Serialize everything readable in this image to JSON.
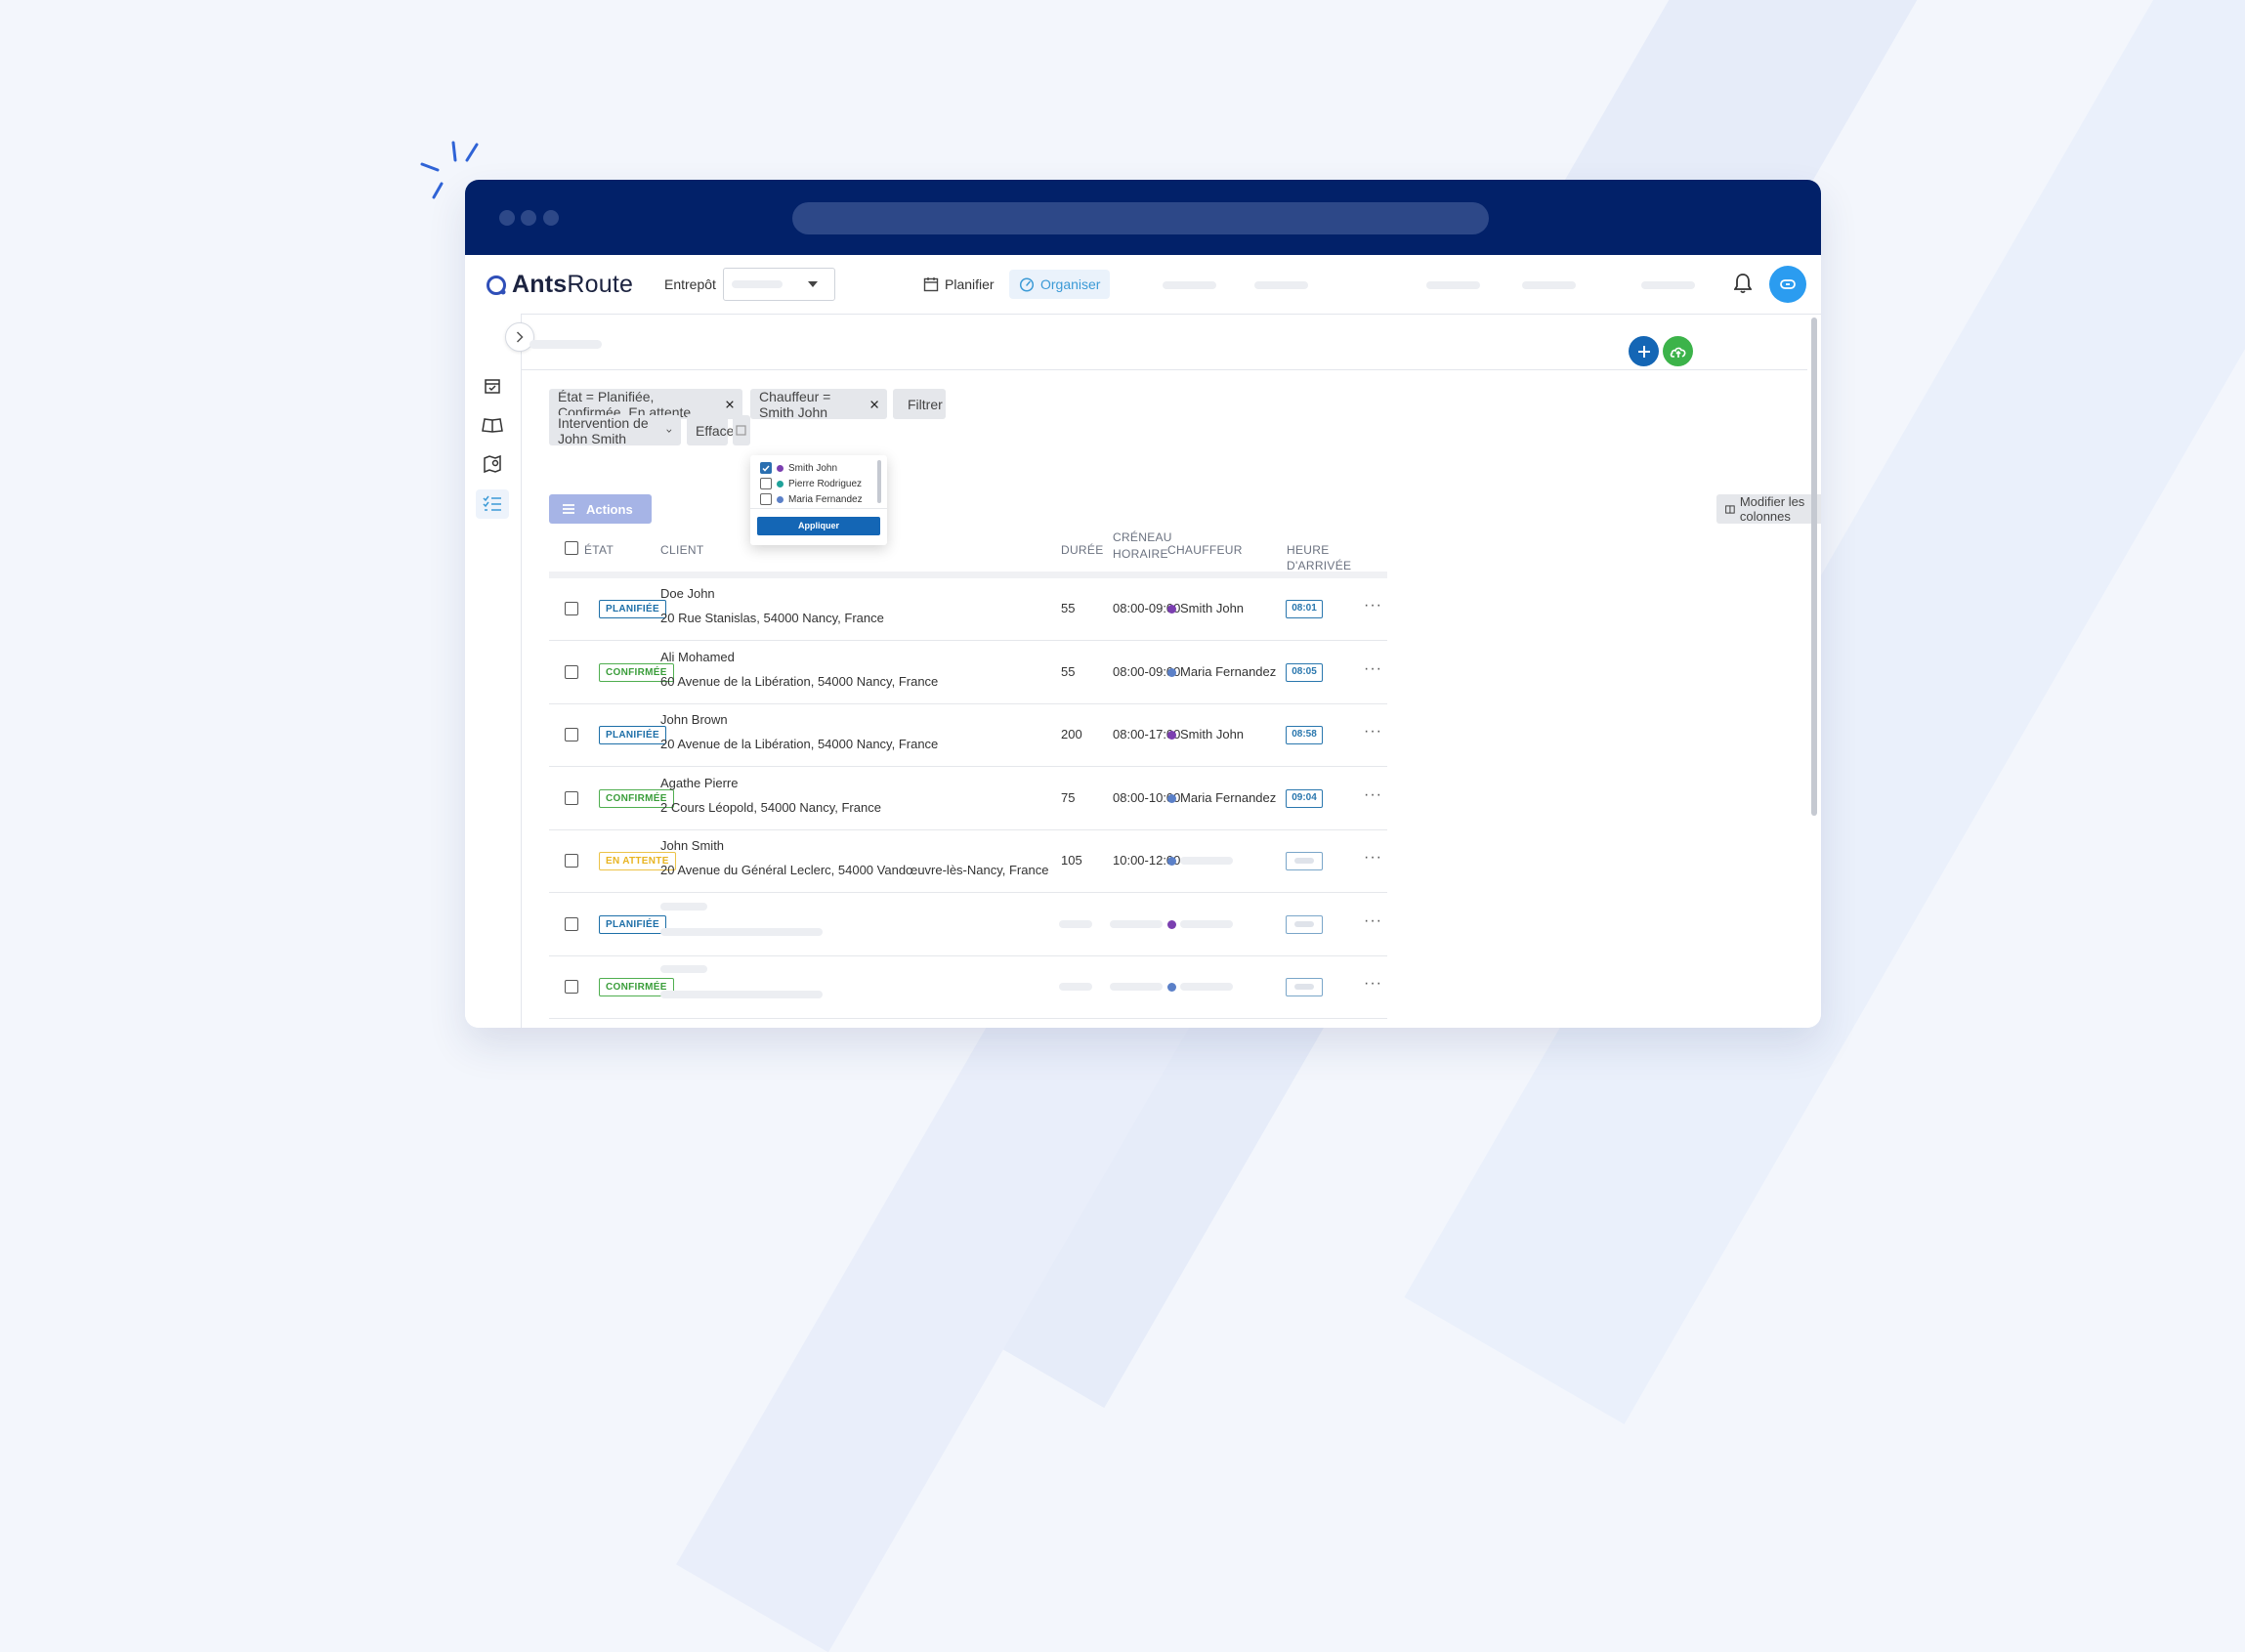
{
  "colors": {
    "chrome": "#022169",
    "accent_blue": "#3b9ad6",
    "planifiee": "#1d6fa8",
    "confirmee": "#3a9d3a",
    "en_attente": "#e8b421",
    "driver_smith": "#7b3fb0",
    "driver_maria": "#5b80c8",
    "driver_pierre": "#1fa29a",
    "apply_button": "#1466b5",
    "add_button": "#1466b5",
    "upload_button": "#3cb34a"
  },
  "header": {
    "logo_bold": "Ants",
    "logo_regular": "Route",
    "warehouse_label": "Entrepôt",
    "nav": [
      {
        "label": "Planifier",
        "icon": "calendar-icon"
      },
      {
        "label": "Organiser",
        "icon": "speedometer-icon"
      }
    ]
  },
  "filters": {
    "chip_state": "État = Planifiée, Confirmée, En attente",
    "chip_driver": "Chauffeur = Smith John",
    "filter_button": "Filtrer",
    "saved_view": "Intervention de John Smith",
    "clear_button": "Effacer"
  },
  "actions_label": "Actions",
  "columns_button": "Modifier les colonnes",
  "dropdown": {
    "options": [
      {
        "label": "Smith John",
        "checked": true,
        "color": "#7b3fb0"
      },
      {
        "label": "Pierre Rodriguez",
        "checked": false,
        "color": "#1fa29a"
      },
      {
        "label": "Maria Fernandez",
        "checked": false,
        "color": "#5b80c8"
      }
    ],
    "apply_label": "Appliquer"
  },
  "table": {
    "headers": {
      "state": "ÉTAT",
      "client": "CLIENT",
      "duration": "DURÉE",
      "slot_line1": "CRÉNEAU",
      "slot_line2": "HORAIRE",
      "driver": "CHAUFFEUR",
      "arrival": "HEURE D'ARRIVÉE"
    },
    "rows": [
      {
        "state": "PLANIFIÉE",
        "state_kind": "planifiee",
        "client": "Doe John",
        "address": "20 Rue Stanislas, 54000 Nancy, France",
        "duration": "55",
        "slot": "08:00-09:00",
        "driver": "Smith John",
        "driver_color": "#7b3fb0",
        "arrival": "08:01"
      },
      {
        "state": "CONFIRMÉE",
        "state_kind": "confirmee",
        "client": "Ali Mohamed",
        "address": "60 Avenue de la Libération, 54000 Nancy, France",
        "duration": "55",
        "slot": "08:00-09:00",
        "driver": "Maria Fernandez",
        "driver_color": "#5b80c8",
        "arrival": "08:05"
      },
      {
        "state": "PLANIFIÉE",
        "state_kind": "planifiee",
        "client": "John Brown",
        "address": "20 Avenue de la Libération, 54000 Nancy, France",
        "duration": "200",
        "slot": "08:00-17:00",
        "driver": "Smith John",
        "driver_color": "#7b3fb0",
        "arrival": "08:58"
      },
      {
        "state": "CONFIRMÉE",
        "state_kind": "confirmee",
        "client": "Agathe Pierre",
        "address": "2 Cours Léopold, 54000 Nancy, France",
        "duration": "75",
        "slot": "08:00-10:00",
        "driver": "Maria Fernandez",
        "driver_color": "#5b80c8",
        "arrival": "09:04"
      },
      {
        "state": "EN ATTENTE",
        "state_kind": "attente",
        "client": "John Smith",
        "address": "20 Avenue du Général Leclerc, 54000 Vandœuvre-lès-Nancy, France",
        "duration": "105",
        "slot": "10:00-12:00",
        "driver": "",
        "driver_color": "#5b80c8",
        "arrival": ""
      },
      {
        "state": "PLANIFIÉE",
        "state_kind": "planifiee",
        "client": "",
        "address": "",
        "duration": "",
        "slot": "",
        "driver": "",
        "driver_color": "#7b3fb0",
        "arrival": ""
      },
      {
        "state": "CONFIRMÉE",
        "state_kind": "confirmee",
        "client": "",
        "address": "",
        "duration": "",
        "slot": "",
        "driver": "",
        "driver_color": "#5b80c8",
        "arrival": ""
      }
    ]
  }
}
